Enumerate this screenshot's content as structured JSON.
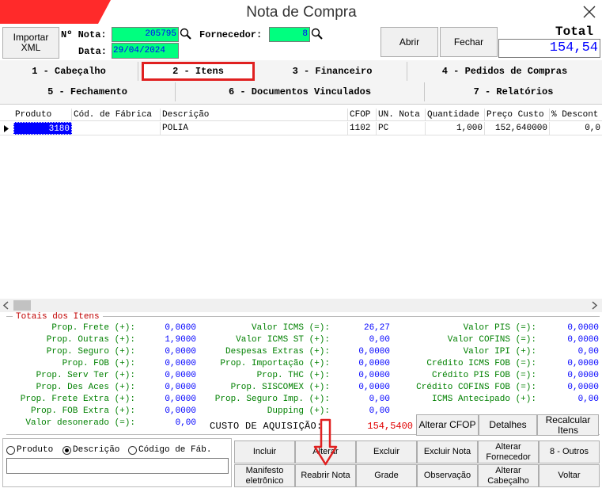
{
  "window": {
    "title": "Nota de Compra",
    "accent": "#ff0000"
  },
  "header": {
    "importar_xml": "Importar\nXML",
    "nota_label": "Nº Nota:",
    "nota_value": "205795",
    "fornecedor_label": "Fornecedor:",
    "fornecedor_value": "8",
    "data_label": "Data:",
    "data_value": "29/04/2024",
    "abrir": "Abrir",
    "fechar": "Fechar",
    "total_label": "Total",
    "total_value": "154,54"
  },
  "tabs": [
    {
      "label": "1 - Cabeçalho"
    },
    {
      "label": "2 - Itens"
    },
    {
      "label": "3 - Financeiro"
    },
    {
      "label": "4 - Pedidos de Compras"
    },
    {
      "label": "5 - Fechamento"
    },
    {
      "label": "6 - Documentos Vinculados"
    },
    {
      "label": "7 - Relatórios"
    }
  ],
  "grid": {
    "columns": [
      "Produto",
      "Cód. de Fábrica",
      "Descrição",
      "CFOP",
      "UN. Nota",
      "Quantidade",
      "Preço Custo",
      "% Descont"
    ],
    "rows": [
      {
        "produto": "3180",
        "cod_fabrica": "",
        "descricao": "POLIA",
        "cfop": "1102",
        "un": "PC",
        "quantidade": "1,000",
        "preco": "152,640000",
        "desconto": "0,0"
      }
    ]
  },
  "totals": {
    "title": "Totais dos Itens",
    "col1": [
      {
        "label": "Prop. Frete (+):",
        "value": "0,0000"
      },
      {
        "label": "Prop. Outras (+):",
        "value": "1,9000"
      },
      {
        "label": "Prop. Seguro (+):",
        "value": "0,0000"
      },
      {
        "label": "Prop. FOB (+):",
        "value": "0,0000"
      },
      {
        "label": "Prop. Serv Ter (+):",
        "value": "0,0000"
      },
      {
        "label": "Prop. Des Aces (+):",
        "value": "0,0000"
      },
      {
        "label": "Prop. Frete Extra (+):",
        "value": "0,0000"
      },
      {
        "label": "Prop. FOB Extra (+):",
        "value": "0,0000"
      },
      {
        "label": "Valor desonerado (=):",
        "value": "0,00"
      }
    ],
    "col2": [
      {
        "label": "Valor ICMS (=):",
        "value": "26,27"
      },
      {
        "label": "Valor ICMS ST (+):",
        "value": "0,00"
      },
      {
        "label": "Despesas Extras (+):",
        "value": "0,0000"
      },
      {
        "label": "Prop. Importação (+):",
        "value": "0,0000"
      },
      {
        "label": "Prop. THC (+):",
        "value": "0,0000"
      },
      {
        "label": "Prop. SISCOMEX (+):",
        "value": "0,0000"
      },
      {
        "label": "Prop. Seguro Imp. (+):",
        "value": "0,00"
      },
      {
        "label": "Dupping (+):",
        "value": "0,00"
      }
    ],
    "col3": [
      {
        "label": "Valor PIS (=):",
        "value": "0,0000"
      },
      {
        "label": "Valor COFINS (=):",
        "value": "0,0000"
      },
      {
        "label": "Valor IPI (+):",
        "value": "0,00"
      },
      {
        "label": "Crédito ICMS FOB (=):",
        "value": "0,0000"
      },
      {
        "label": "Crédito PIS FOB (=):",
        "value": "0,0000"
      },
      {
        "label": "Crédito COFINS FOB (=):",
        "value": "0,0000"
      },
      {
        "label": "ICMS Antecipado (+):",
        "value": "0,00"
      }
    ],
    "custo_label": "CUSTO DE AQUISIÇÃO:",
    "custo_value": "154,5400",
    "alterar_cfop": "Alterar CFOP",
    "detalhes": "Detalhes",
    "recalcular": "Recalcular\nItens"
  },
  "search": {
    "options": [
      "Produto",
      "Descrição",
      "Código de Fáb."
    ],
    "selected": "Descrição",
    "value": ""
  },
  "actions": {
    "row1": [
      "Incluir",
      "Alterar",
      "Excluir",
      "Excluir Nota",
      "Alterar\nFornecedor",
      "8 - Outros"
    ],
    "row2": [
      "Manifesto\neletrônico",
      "Reabrir Nota",
      "Grade",
      "Observação",
      "Alterar\nCabeçalho",
      "Voltar"
    ]
  }
}
